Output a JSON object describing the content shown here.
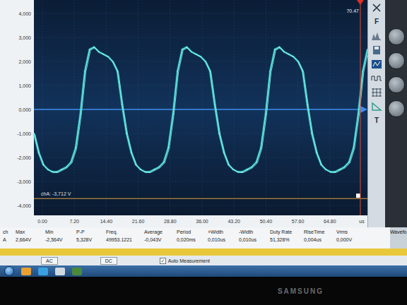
{
  "chart": {
    "y_ticks": [
      "4,000",
      "3,000",
      "2,000",
      "1,000",
      "0,000",
      "-1,000",
      "-2,000",
      "-3,000",
      "-4,000"
    ],
    "x_ticks": [
      "0.00",
      "7.20",
      "14.40",
      "21.60",
      "28.80",
      "36.00",
      "43.20",
      "50.40",
      "57.60",
      "64.80",
      "us"
    ],
    "series": [
      {
        "name": "A",
        "values": [
          -1.0,
          -1.8,
          -2.3,
          -2.5,
          -2.6,
          -2.6,
          -2.5,
          -2.4,
          -2.2,
          -1.6,
          -0.2,
          1.6,
          2.5,
          2.6,
          2.4,
          2.3,
          2.2,
          2.0,
          1.6,
          0.2,
          -1.0,
          -1.8,
          -2.3,
          -2.5,
          -2.6,
          -2.6,
          -2.5,
          -2.4,
          -2.2,
          -1.6,
          -0.2,
          1.6,
          2.5,
          2.6,
          2.4,
          2.3,
          2.2,
          2.0,
          1.6,
          0.2,
          -1.0,
          -1.8,
          -2.3,
          -2.5,
          -2.6,
          -2.6,
          -2.5,
          -2.4,
          -2.2,
          -1.6,
          -0.2,
          1.6,
          2.5,
          2.6,
          2.4,
          2.3,
          2.2,
          2.0,
          1.6,
          0.2,
          -1.0,
          -1.8,
          -2.3,
          -2.5,
          -2.6,
          -2.6,
          -2.5,
          -2.4,
          -2.2,
          -1.6,
          -0.2,
          1.6,
          2.5
        ]
      }
    ],
    "trigger_label": "chA: -3,712 V",
    "trigger_level": -3.712,
    "cursor_label": "70.47",
    "cursor_time": 70.47
  },
  "toolbar": {
    "items": [
      "F",
      "T"
    ]
  },
  "side_panel": {
    "label": "Wavefo"
  },
  "measurements": {
    "columns": [
      "ch",
      "Max",
      "Min",
      "P-P",
      "Freq.",
      "Average",
      "Period",
      "+Width",
      "-Width",
      "Duty Rate",
      "RiseTime",
      "Vrms"
    ],
    "rows": [
      [
        "A",
        "2,664V",
        "-2,564V",
        "5,328V",
        "49953.1221",
        "-0,043V",
        "0,020ms",
        "0,010us",
        "0,010us",
        "51,328%",
        "0,004us",
        "0,000V"
      ]
    ]
  },
  "options": [
    {
      "label": "AC",
      "kind": "button",
      "checked": false
    },
    {
      "label": "DC",
      "kind": "button",
      "checked": false
    },
    {
      "label": "Auto Measurement",
      "kind": "checkbox",
      "checked": true
    }
  ],
  "monitor": {
    "brand": "SAMSUNG"
  }
}
